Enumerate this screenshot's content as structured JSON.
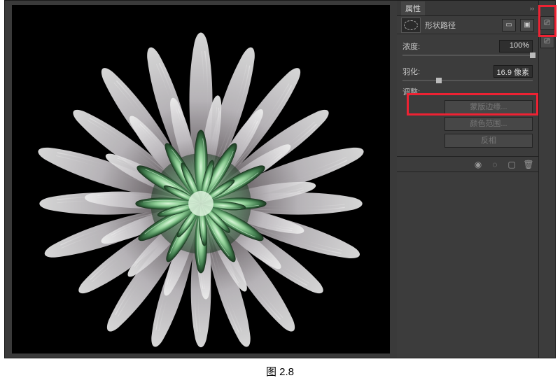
{
  "panel": {
    "title": "属性",
    "collapse_marker": "››",
    "mask_type": "形状路径",
    "icon_btn1": "▭",
    "icon_btn2": "▣",
    "density": {
      "label": "浓度:",
      "value": "100%",
      "pos": 100
    },
    "feather": {
      "label": "羽化:",
      "value": "16.9 像素",
      "pos": 28
    },
    "adjust": {
      "heading": "调整:",
      "mask_edge": "蒙版边缘...",
      "color_range": "颜色范围...",
      "invert": "反相"
    },
    "footer_eye": "◉",
    "footer_sel": "◌",
    "footer_new": "▢",
    "footer_trash": "🗑"
  },
  "strip": {
    "icon1": "⎚",
    "icon2": "⎚"
  },
  "caption": "图  2.8"
}
